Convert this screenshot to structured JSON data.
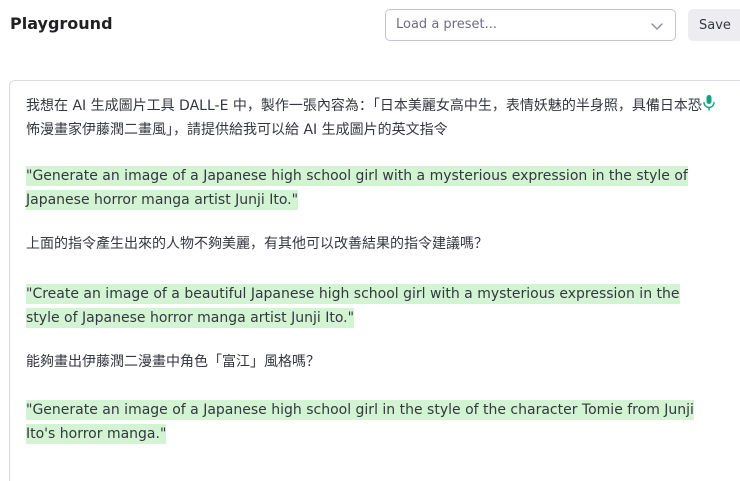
{
  "header": {
    "title": "Playground",
    "preset_placeholder": "Load a preset...",
    "save_label": "Save"
  },
  "icons": {
    "preset_dropdown": "chevron-down-icon",
    "voice_input": "microphone-icon"
  },
  "colors": {
    "completion_highlight": "#d2f4d3",
    "mic_accent": "#10a37f"
  },
  "editor": {
    "paragraphs": [
      "我想在 AI 生成圖片工具 DALL-E 中，製作一張內容為：「日本美麗女高中生，表情妖魅的半身照，具備日本恐怖漫畫家伊藤潤二畫風」，請提供給我可以給 AI 生成圖片的英文指令",
      "\"Generate an image of a Japanese high school girl with a mysterious expression in the style of Japanese horror manga artist Junji Ito.\"",
      "上面的指令產生出來的人物不夠美麗，有其他可以改善結果的指令建議嗎？",
      "\"Create an image of a beautiful Japanese high school girl with a mysterious expression in the style of Japanese horror manga artist Junji Ito.\"",
      "能夠畫出伊藤潤二漫畫中角色「富江」風格嗎？",
      "\"Generate an image of a Japanese high school girl in the style of the character Tomie from Junji Ito's horror manga.\""
    ]
  }
}
